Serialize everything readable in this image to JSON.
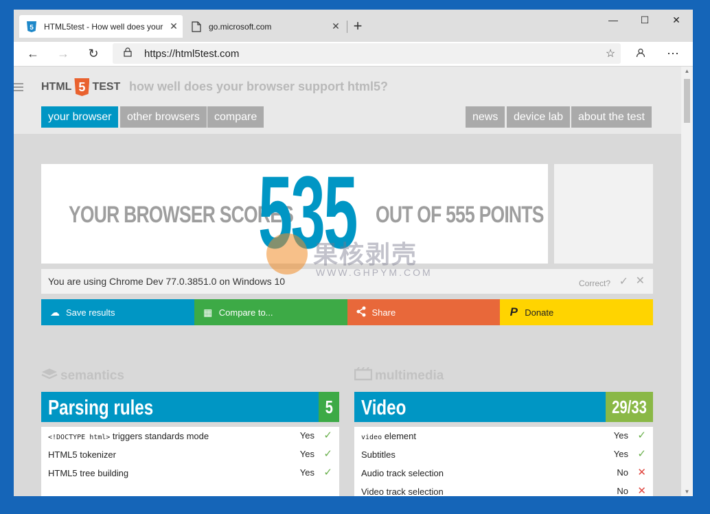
{
  "browser": {
    "tabs": [
      {
        "title": "HTML5test - How well does your"
      },
      {
        "title": "go.microsoft.com"
      }
    ],
    "new_tab": "+",
    "controls": {
      "minimize": "—",
      "maximize": "☐",
      "close": "✕"
    },
    "url": "https://html5test.com"
  },
  "site": {
    "logo_left": "HTML",
    "logo_mid": "5",
    "logo_right": "TEST",
    "tagline": "how well does your browser support html5?",
    "nav_left": [
      "your browser",
      "other browsers",
      "compare"
    ],
    "nav_right": [
      "news",
      "device lab",
      "about the test"
    ]
  },
  "score": {
    "prefix": "YOUR BROWSER SCORES",
    "value": "535",
    "suffix": "OUT OF 555 POINTS"
  },
  "info": {
    "user_agent": "You are using Chrome Dev 77.0.3851.0 on Windows 10",
    "correct_label": "Correct?"
  },
  "actions": [
    {
      "label": "Save results",
      "color": "#0096c4",
      "icon": "cloud-upload-icon"
    },
    {
      "label": "Compare to...",
      "color": "#3daa46",
      "icon": "grid-icon"
    },
    {
      "label": "Share",
      "color": "#e8683a",
      "icon": "share-icon"
    },
    {
      "label": "Donate",
      "color": "#ffd400",
      "icon": "paypal-icon"
    }
  ],
  "sections": {
    "left": {
      "name": "semantics",
      "category": "Parsing rules",
      "score": "5",
      "score_color": "#3daa46",
      "rows": [
        {
          "code": "<!DOCTYPE html>",
          "label": " triggers standards mode",
          "result": "Yes"
        },
        {
          "label": "HTML5 tokenizer",
          "result": "Yes"
        },
        {
          "label": "HTML5 tree building",
          "result": "Yes"
        }
      ]
    },
    "right": {
      "name": "multimedia",
      "category": "Video",
      "score": "29/33",
      "score_color": "#8ab846",
      "rows": [
        {
          "code": "video",
          "label": " element",
          "result": "Yes"
        },
        {
          "label": "Subtitles",
          "result": "Yes"
        },
        {
          "label": "Audio track selection",
          "result": "No"
        },
        {
          "label": "Video track selection",
          "result": "No"
        }
      ]
    }
  },
  "watermark": {
    "text": "果核剥壳",
    "url": "WWW.GHPYM.COM"
  }
}
